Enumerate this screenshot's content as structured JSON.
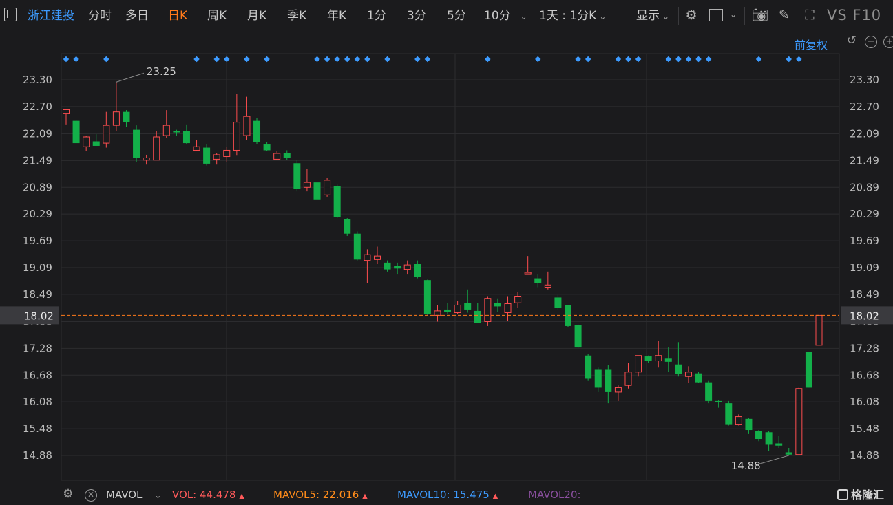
{
  "toolbar": {
    "stock_name": "浙江建投",
    "tabs": [
      "分时",
      "多日",
      "日K",
      "周K",
      "月K",
      "季K",
      "年K",
      "1分",
      "3分",
      "5分",
      "10分"
    ],
    "active_tab": "日K",
    "period_select": "1天 : 1分K",
    "display_label": "显示",
    "vs_f10": "VS F10"
  },
  "adjust_label": "前复权",
  "bottom": {
    "indicator": "MAVOL",
    "vol_label": "VOL:",
    "vol_value": "44.478",
    "mavol5_label": "MAVOL5:",
    "mavol5_value": "22.016",
    "mavol10_label": "MAVOL10:",
    "mavol10_value": "15.475",
    "mavol20_label": "MAVOL20:",
    "logo_text": "格隆汇"
  },
  "colors": {
    "up": "#ff4d4f",
    "down": "#13b04a",
    "accent": "#ff7a1a",
    "blue": "#3d9bff"
  },
  "chart_data": {
    "type": "candlestick",
    "ylim": [
      14.58,
      23.6
    ],
    "y_ticks": [
      "23.30",
      "22.70",
      "22.09",
      "21.49",
      "20.89",
      "20.29",
      "19.69",
      "19.09",
      "18.49",
      "17.88",
      "17.28",
      "16.68",
      "16.08",
      "15.48",
      "14.88"
    ],
    "current_price": "18.02",
    "max_label": "23.25",
    "min_label": "14.88",
    "marker_indices": [
      0,
      1,
      4,
      13,
      15,
      16,
      18,
      20,
      25,
      26,
      27,
      28,
      29,
      30,
      32,
      35,
      36,
      42,
      47,
      51,
      52,
      55,
      56,
      57,
      60,
      61,
      62,
      63,
      64,
      69,
      72,
      73
    ],
    "candles": [
      {
        "o": 22.55,
        "h": 22.65,
        "l": 22.3,
        "c": 22.63
      },
      {
        "o": 22.38,
        "h": 22.4,
        "l": 21.88,
        "c": 21.88
      },
      {
        "o": 21.8,
        "h": 22.05,
        "l": 21.7,
        "c": 22.02
      },
      {
        "o": 21.92,
        "h": 22.08,
        "l": 21.82,
        "c": 21.82
      },
      {
        "o": 21.88,
        "h": 22.58,
        "l": 21.78,
        "c": 22.28
      },
      {
        "o": 22.28,
        "h": 23.25,
        "l": 22.15,
        "c": 22.58
      },
      {
        "o": 22.58,
        "h": 22.62,
        "l": 22.25,
        "c": 22.35
      },
      {
        "o": 22.18,
        "h": 22.28,
        "l": 21.45,
        "c": 21.55
      },
      {
        "o": 21.5,
        "h": 21.62,
        "l": 21.4,
        "c": 21.55
      },
      {
        "o": 21.5,
        "h": 22.15,
        "l": 21.5,
        "c": 22.02
      },
      {
        "o": 22.05,
        "h": 22.62,
        "l": 22.0,
        "c": 22.28
      },
      {
        "o": 22.15,
        "h": 22.18,
        "l": 22.05,
        "c": 22.12
      },
      {
        "o": 22.15,
        "h": 22.3,
        "l": 21.85,
        "c": 21.88
      },
      {
        "o": 21.72,
        "h": 21.95,
        "l": 21.7,
        "c": 21.8
      },
      {
        "o": 21.78,
        "h": 21.85,
        "l": 21.38,
        "c": 21.42
      },
      {
        "o": 21.52,
        "h": 21.66,
        "l": 21.4,
        "c": 21.62
      },
      {
        "o": 21.58,
        "h": 21.8,
        "l": 21.45,
        "c": 21.72
      },
      {
        "o": 21.72,
        "h": 22.98,
        "l": 21.6,
        "c": 22.35
      },
      {
        "o": 22.05,
        "h": 22.92,
        "l": 21.95,
        "c": 22.48
      },
      {
        "o": 22.38,
        "h": 22.45,
        "l": 21.86,
        "c": 21.9
      },
      {
        "o": 21.85,
        "h": 21.9,
        "l": 21.7,
        "c": 21.72
      },
      {
        "o": 21.52,
        "h": 21.7,
        "l": 21.5,
        "c": 21.65
      },
      {
        "o": 21.65,
        "h": 21.72,
        "l": 21.5,
        "c": 21.55
      },
      {
        "o": 21.43,
        "h": 21.5,
        "l": 20.8,
        "c": 20.86
      },
      {
        "o": 20.89,
        "h": 21.3,
        "l": 20.8,
        "c": 21.0
      },
      {
        "o": 21.0,
        "h": 21.05,
        "l": 20.58,
        "c": 20.62
      },
      {
        "o": 20.72,
        "h": 21.1,
        "l": 20.68,
        "c": 21.05
      },
      {
        "o": 20.92,
        "h": 20.95,
        "l": 20.2,
        "c": 20.22
      },
      {
        "o": 20.18,
        "h": 20.2,
        "l": 19.8,
        "c": 19.85
      },
      {
        "o": 19.85,
        "h": 19.9,
        "l": 19.25,
        "c": 19.27
      },
      {
        "o": 19.25,
        "h": 19.5,
        "l": 18.75,
        "c": 19.38
      },
      {
        "o": 19.27,
        "h": 19.56,
        "l": 19.18,
        "c": 19.35
      },
      {
        "o": 19.2,
        "h": 19.25,
        "l": 19.0,
        "c": 19.05
      },
      {
        "o": 19.13,
        "h": 19.2,
        "l": 18.95,
        "c": 19.07
      },
      {
        "o": 19.05,
        "h": 19.25,
        "l": 18.95,
        "c": 19.15
      },
      {
        "o": 19.18,
        "h": 19.25,
        "l": 18.85,
        "c": 18.88
      },
      {
        "o": 18.81,
        "h": 18.82,
        "l": 18.02,
        "c": 18.05
      },
      {
        "o": 18.02,
        "h": 18.25,
        "l": 17.88,
        "c": 18.12
      },
      {
        "o": 18.15,
        "h": 18.3,
        "l": 18.05,
        "c": 18.1
      },
      {
        "o": 18.08,
        "h": 18.35,
        "l": 18.05,
        "c": 18.25
      },
      {
        "o": 18.3,
        "h": 18.6,
        "l": 18.08,
        "c": 18.15
      },
      {
        "o": 18.12,
        "h": 18.3,
        "l": 17.85,
        "c": 17.85
      },
      {
        "o": 17.88,
        "h": 18.45,
        "l": 17.78,
        "c": 18.4
      },
      {
        "o": 18.3,
        "h": 18.4,
        "l": 18.1,
        "c": 18.22
      },
      {
        "o": 18.08,
        "h": 18.45,
        "l": 17.9,
        "c": 18.28
      },
      {
        "o": 18.3,
        "h": 18.55,
        "l": 18.18,
        "c": 18.45
      },
      {
        "o": 18.95,
        "h": 19.35,
        "l": 18.95,
        "c": 18.98
      },
      {
        "o": 18.85,
        "h": 18.95,
        "l": 18.65,
        "c": 18.75
      },
      {
        "o": 18.65,
        "h": 19.0,
        "l": 18.6,
        "c": 18.7
      },
      {
        "o": 18.42,
        "h": 18.48,
        "l": 18.15,
        "c": 18.18
      },
      {
        "o": 18.25,
        "h": 18.25,
        "l": 17.75,
        "c": 17.78
      },
      {
        "o": 17.8,
        "h": 17.82,
        "l": 17.28,
        "c": 17.3
      },
      {
        "o": 17.12,
        "h": 17.15,
        "l": 16.55,
        "c": 16.6
      },
      {
        "o": 16.8,
        "h": 16.85,
        "l": 16.3,
        "c": 16.4
      },
      {
        "o": 16.8,
        "h": 16.9,
        "l": 16.05,
        "c": 16.3
      },
      {
        "o": 16.3,
        "h": 16.45,
        "l": 16.1,
        "c": 16.4
      },
      {
        "o": 16.45,
        "h": 16.95,
        "l": 16.38,
        "c": 16.75
      },
      {
        "o": 16.75,
        "h": 17.12,
        "l": 16.65,
        "c": 17.12
      },
      {
        "o": 17.1,
        "h": 17.12,
        "l": 16.95,
        "c": 17.0
      },
      {
        "o": 17.0,
        "h": 17.45,
        "l": 16.85,
        "c": 17.12
      },
      {
        "o": 17.05,
        "h": 17.3,
        "l": 16.75,
        "c": 16.98
      },
      {
        "o": 16.92,
        "h": 17.42,
        "l": 16.65,
        "c": 16.7
      },
      {
        "o": 16.65,
        "h": 16.88,
        "l": 16.5,
        "c": 16.75
      },
      {
        "o": 16.72,
        "h": 16.75,
        "l": 16.5,
        "c": 16.52
      },
      {
        "o": 16.52,
        "h": 16.55,
        "l": 16.05,
        "c": 16.1
      },
      {
        "o": 16.1,
        "h": 16.12,
        "l": 15.95,
        "c": 16.08
      },
      {
        "o": 16.05,
        "h": 16.1,
        "l": 15.55,
        "c": 15.58
      },
      {
        "o": 15.58,
        "h": 15.8,
        "l": 15.55,
        "c": 15.75
      },
      {
        "o": 15.7,
        "h": 15.72,
        "l": 15.36,
        "c": 15.45
      },
      {
        "o": 15.43,
        "h": 15.45,
        "l": 15.2,
        "c": 15.25
      },
      {
        "o": 15.4,
        "h": 15.42,
        "l": 14.98,
        "c": 15.12
      },
      {
        "o": 15.15,
        "h": 15.32,
        "l": 15.05,
        "c": 15.1
      },
      {
        "o": 14.95,
        "h": 15.05,
        "l": 14.88,
        "c": 14.9
      },
      {
        "o": 14.9,
        "h": 16.4,
        "l": 14.88,
        "c": 16.38
      },
      {
        "o": 17.2,
        "h": 17.2,
        "l": 16.4,
        "c": 16.4
      },
      {
        "o": 17.35,
        "h": 18.02,
        "l": 17.35,
        "c": 18.02
      }
    ]
  }
}
